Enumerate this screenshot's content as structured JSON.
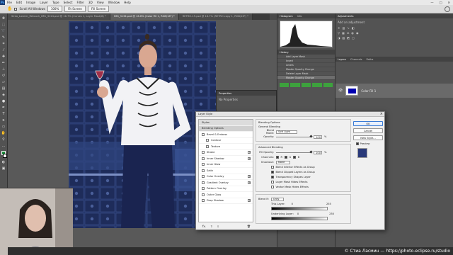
{
  "menubar": {
    "app_icon": "Ps",
    "items": [
      "File",
      "Edit",
      "Image",
      "Layer",
      "Type",
      "Select",
      "Filter",
      "3D",
      "View",
      "Window",
      "Help"
    ],
    "window_controls": [
      "—",
      "□",
      "✕"
    ]
  },
  "options": {
    "scroll_all": "Scroll All Windows",
    "zoom": "100%",
    "fit_screen": "Fit Screen",
    "fill_screen": "Fill Screen"
  },
  "tabs": [
    {
      "label": "Sirea_Lasmin_Retouch_IMG_3124.psd @ 16.7% (Curves 1, Layer Mask/8) *"
    },
    {
      "label": "IMG_3134.psd @ 16.6% (Color Fill 1, RGB/16*) *",
      "active": true
    },
    {
      "label": "RETRO-19.psd @ 16.7% (RETRO copy 1, RGB/16*) *"
    }
  ],
  "panels": {
    "histogram_tab": "Histogram",
    "info_tab": "Info",
    "history_tab": "History",
    "history_items": [
      "Add Layer Mask",
      "Invert",
      "Levels",
      "Master Opacity Change",
      "Delete Layer Mask",
      "Master Opacity Change"
    ],
    "adjustments_tab": "Adjustments",
    "add_adjustment": "Add an adjustment",
    "layers_tabs": [
      "Layers",
      "Channels",
      "Paths"
    ],
    "layer_name": "Color Fill 1",
    "properties_title": "Properties",
    "properties_text": "No Properties"
  },
  "dialog": {
    "title": "Layer Style",
    "styles_header": "Styles",
    "blending_options": "Blending Options",
    "style_items": [
      {
        "label": "Bevel & Emboss",
        "plus": false
      },
      {
        "label": "Contour",
        "plus": false,
        "indent": true
      },
      {
        "label": "Texture",
        "plus": false,
        "indent": true
      },
      {
        "label": "Stroke",
        "plus": true
      },
      {
        "label": "Inner Shadow",
        "plus": true
      },
      {
        "label": "Inner Glow",
        "plus": false
      },
      {
        "label": "Satin",
        "plus": false
      },
      {
        "label": "Color Overlay",
        "plus": true
      },
      {
        "label": "Gradient Overlay",
        "plus": true
      },
      {
        "label": "Pattern Overlay",
        "plus": false
      },
      {
        "label": "Outer Glow",
        "plus": false
      },
      {
        "label": "Drop Shadow",
        "plus": true
      }
    ],
    "fx": "fx.",
    "main": {
      "group_title": "Blending Options",
      "general": "General Blending",
      "blend_mode_label": "Blend Mode:",
      "blend_mode": "Soft Light",
      "opacity_label": "Opacity:",
      "opacity": "100",
      "advanced": "Advanced Blending",
      "fill_opacity_label": "Fill Opacity:",
      "fill_opacity": "100",
      "channels_label": "Channels:",
      "channels": [
        "R",
        "G",
        "B"
      ],
      "knockout_label": "Knockout:",
      "knockout": "None",
      "checks": [
        {
          "label": "Blend Interior Effects as Group",
          "on": false
        },
        {
          "label": "Blend Clipped Layers as Group",
          "on": true
        },
        {
          "label": "Transparency Shapes Layer",
          "on": true
        },
        {
          "label": "Layer Mask Hides Effects",
          "on": false
        },
        {
          "label": "Vector Mask Hides Effects",
          "on": false
        }
      ],
      "blend_if_label": "Blend If:",
      "blend_if": "Gray",
      "this_layer_label": "This Layer:",
      "this_layer_lo": "0",
      "this_layer_hi": "255",
      "underlying_label": "Underlying Layer:",
      "underlying_lo": "0",
      "underlying_hi": "255"
    },
    "buttons": {
      "ok": "OK",
      "cancel": "Cancel",
      "new_style": "New Style...",
      "preview": "Preview"
    }
  },
  "watermark": "© Стиа Ласмин — https://photo-eclipse.ru/studio",
  "colors": {
    "accent": "#3a7bd5",
    "fill_layer": "#0000b0",
    "photo_bg": "#273b72"
  }
}
